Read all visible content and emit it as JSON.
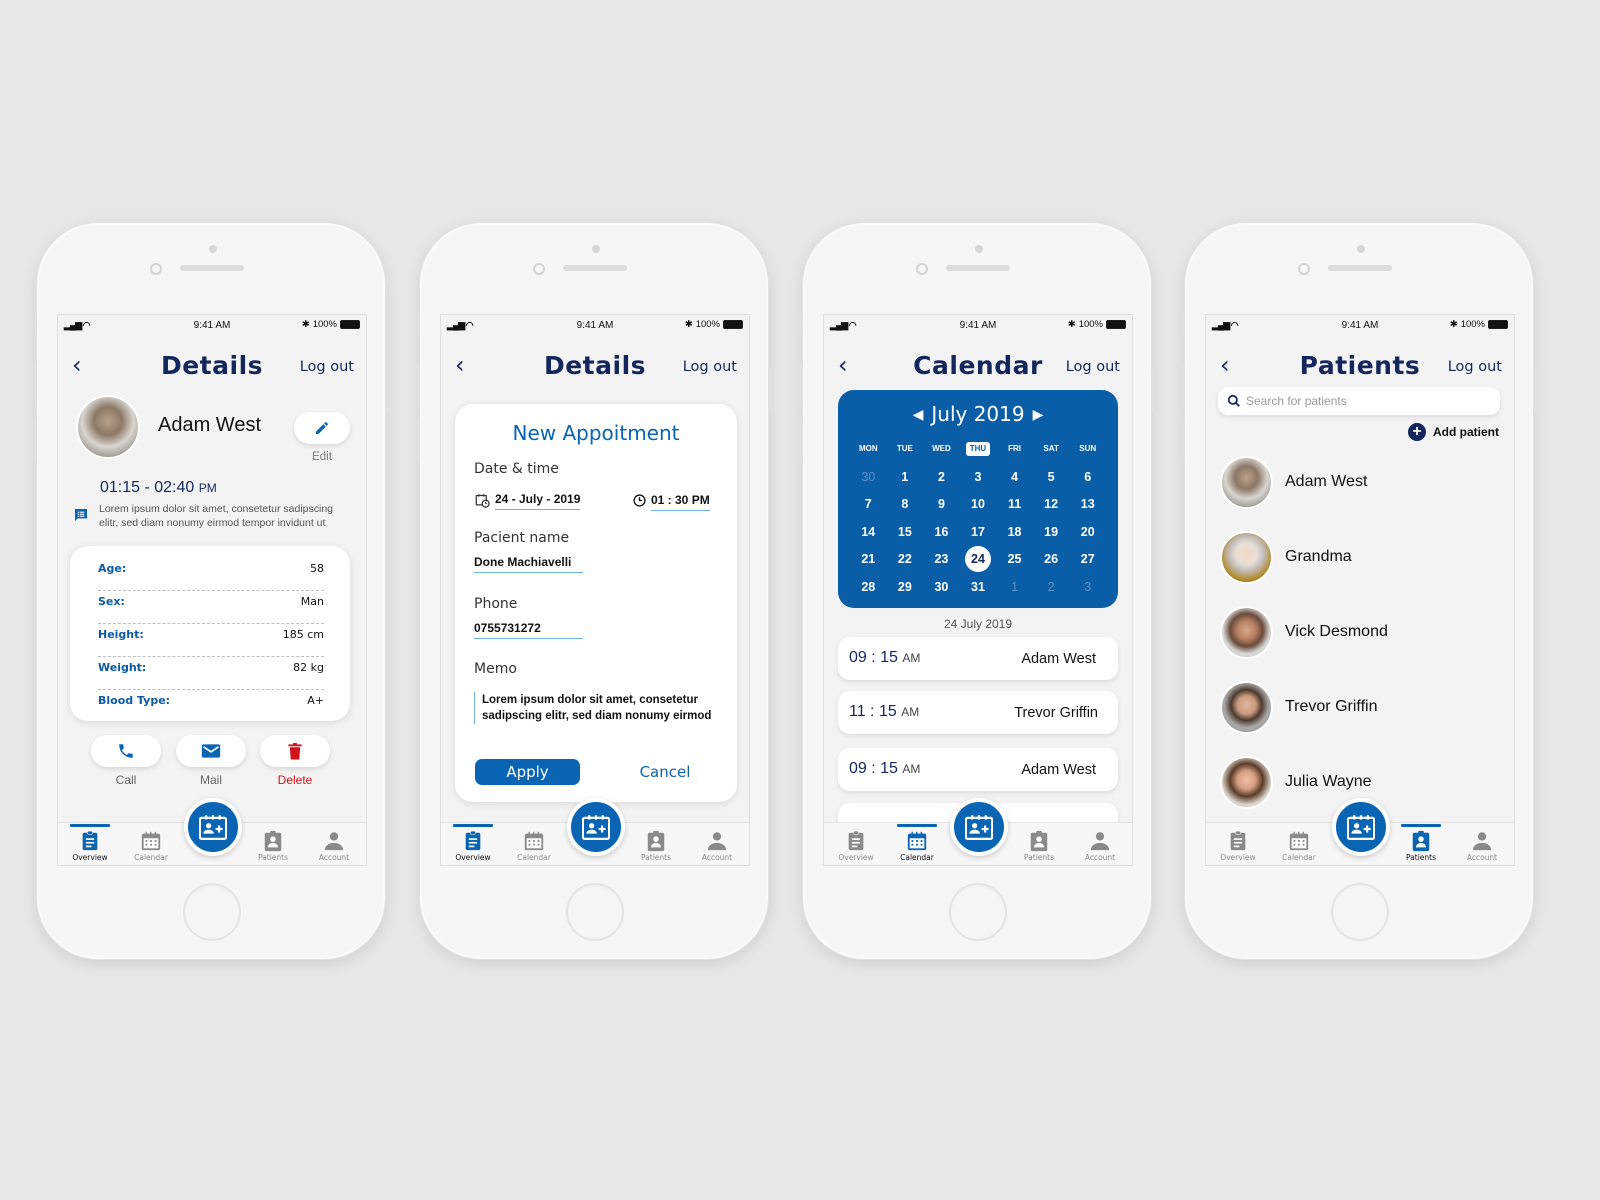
{
  "status_bar": {
    "time": "9:41 AM",
    "battery": "100%"
  },
  "tabbar": {
    "tabs": [
      {
        "label": "Overview",
        "icon": "clipboard-icon"
      },
      {
        "label": "Calendar",
        "icon": "calendar-icon"
      },
      {
        "label": "Patients",
        "icon": "badge-icon"
      },
      {
        "label": "Account",
        "icon": "person-icon"
      }
    ],
    "fab_icon": "add-appointment-icon"
  },
  "colors": {
    "primary": "#0a64b4",
    "navy": "#13275d",
    "danger": "#d0131a",
    "background": "#e7e7e7"
  },
  "screen1": {
    "title": "Details",
    "logout": "Log out",
    "patient_name": "Adam West",
    "edit_label": "Edit",
    "time_range": "01:15 - 02:40",
    "time_suffix": "PM",
    "note": "Lorem ipsum dolor sit amet, consetetur sadipscing elitr, sed diam nonumy eirmod tempor invidunt ut",
    "info": [
      {
        "key": "Age:",
        "value": "58"
      },
      {
        "key": "Sex:",
        "value": "Man"
      },
      {
        "key": "Height:",
        "value": "185 cm"
      },
      {
        "key": "Weight:",
        "value": "82 kg"
      },
      {
        "key": "Blood Type:",
        "value": "A+"
      }
    ],
    "actions": {
      "call": "Call",
      "mail": "Mail",
      "delete": "Delete"
    },
    "active_tab": "Overview"
  },
  "screen2": {
    "title": "Details",
    "logout": "Log out",
    "card_title": "New Appoitment",
    "date_time_label": "Date & time",
    "date_value": "24 - July - 2019",
    "time_value": "01 : 30 PM",
    "patient_label": "Pacient name",
    "patient_value": "Done Machiavelli",
    "phone_label": "Phone",
    "phone_value": "0755731272",
    "memo_label": "Memo",
    "memo_value": "Lorem ipsum dolor sit amet, consetetur sadipscing elitr, sed diam nonumy eirmod",
    "apply": "Apply",
    "cancel": "Cancel",
    "active_tab": "Overview"
  },
  "screen3": {
    "title": "Calendar",
    "logout": "Log out",
    "month": "July 2019",
    "weekdays": [
      "MON",
      "TUE",
      "WED",
      "THU",
      "FRI",
      "SAT",
      "SUN"
    ],
    "highlighted_weekday": "THU",
    "days": [
      {
        "d": "30",
        "m": true
      },
      {
        "d": "1"
      },
      {
        "d": "2"
      },
      {
        "d": "3"
      },
      {
        "d": "4"
      },
      {
        "d": "5"
      },
      {
        "d": "6"
      },
      {
        "d": "7"
      },
      {
        "d": "8"
      },
      {
        "d": "9"
      },
      {
        "d": "10"
      },
      {
        "d": "11"
      },
      {
        "d": "12"
      },
      {
        "d": "13"
      },
      {
        "d": "14"
      },
      {
        "d": "15"
      },
      {
        "d": "16"
      },
      {
        "d": "17"
      },
      {
        "d": "18"
      },
      {
        "d": "19"
      },
      {
        "d": "20"
      },
      {
        "d": "21"
      },
      {
        "d": "22"
      },
      {
        "d": "23"
      },
      {
        "d": "24",
        "s": true
      },
      {
        "d": "25"
      },
      {
        "d": "26"
      },
      {
        "d": "27"
      },
      {
        "d": "28"
      },
      {
        "d": "29"
      },
      {
        "d": "30"
      },
      {
        "d": "31"
      },
      {
        "d": "1",
        "m": true
      },
      {
        "d": "2",
        "m": true
      },
      {
        "d": "3",
        "m": true
      }
    ],
    "selected_date": "24 July 2019",
    "appointments": [
      {
        "time": "09 : 15",
        "ampm": "AM",
        "name": "Adam West"
      },
      {
        "time": "11 : 15",
        "ampm": "AM",
        "name": "Trevor Griffin"
      },
      {
        "time": "09 : 15",
        "ampm": "AM",
        "name": "Adam West"
      }
    ],
    "active_tab": "Calendar"
  },
  "screen4": {
    "title": "Patients",
    "logout": "Log out",
    "search_placeholder": "Search for patients",
    "add_patient": "Add patient",
    "patients": [
      {
        "name": "Adam West"
      },
      {
        "name": "Grandma"
      },
      {
        "name": "Vick Desmond"
      },
      {
        "name": "Trevor Griffin"
      },
      {
        "name": "Julia Wayne"
      }
    ],
    "active_tab": "Patients"
  }
}
